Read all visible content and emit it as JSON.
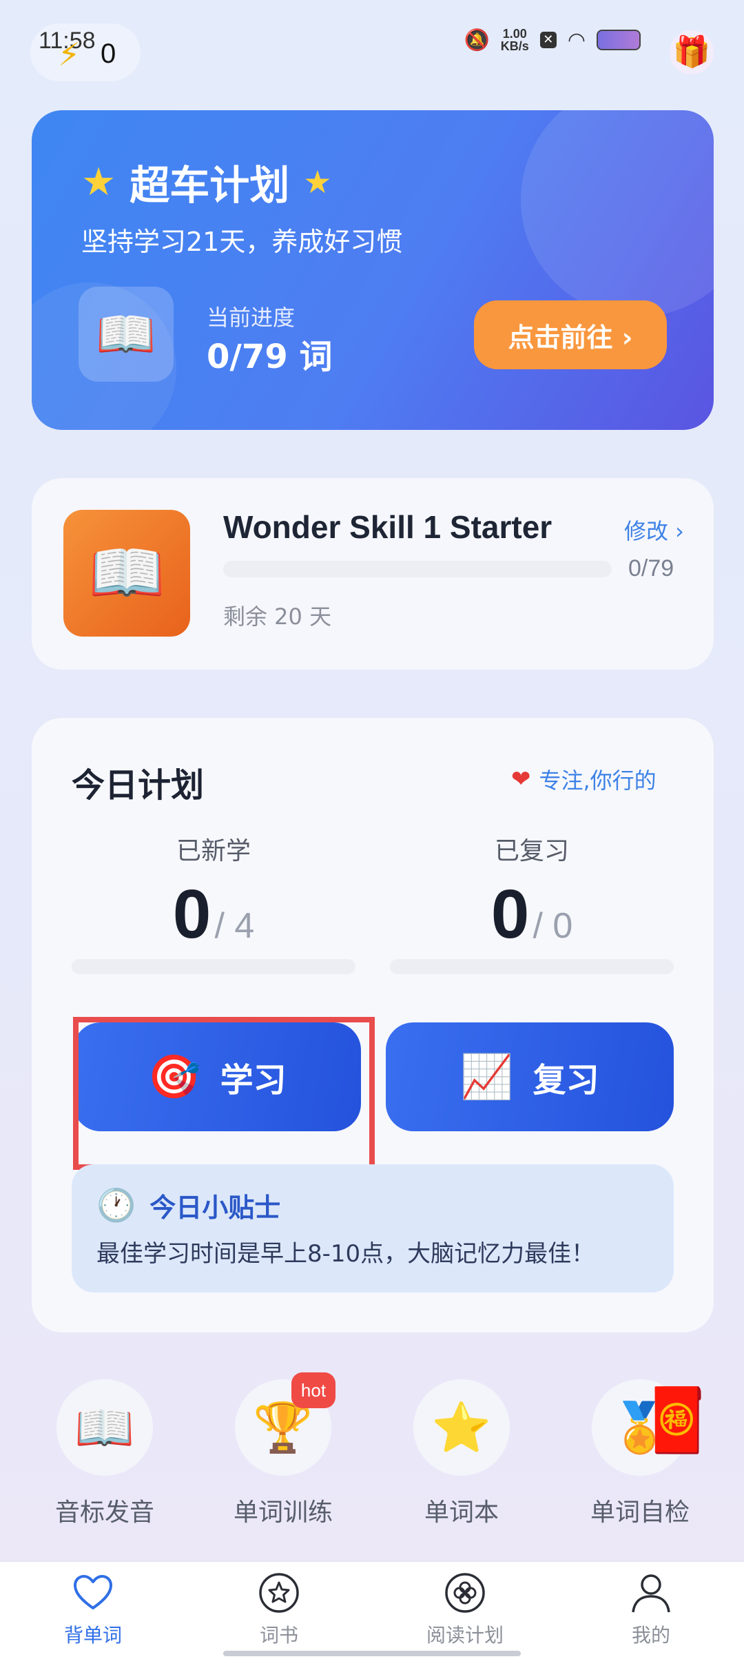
{
  "status_bar": {
    "time": "11:58",
    "notification_count": "0",
    "net_speed_value": "1.00",
    "net_speed_unit": "KB/s"
  },
  "hero": {
    "title": "超车计划",
    "subtitle": "坚持学习21天，养成好习惯",
    "progress_label": "当前进度",
    "progress_value": "0/79 词",
    "cta_label": "点击前往 ›"
  },
  "book": {
    "title": "Wonder Skill 1 Starter",
    "edit_label": "修改 ›",
    "progress_text": "0/79",
    "progress_fraction": 0,
    "remaining": "剩余 20 天"
  },
  "plan": {
    "title": "今日计划",
    "slogan": "专注,你行的",
    "new_label": "已新学",
    "new_done": "0",
    "new_total": "/ 4",
    "review_label": "已复习",
    "review_done": "0",
    "review_total": "/ 0",
    "study_button": "学习",
    "review_button": "复习",
    "tip_title": "今日小贴士",
    "tip_text": "最佳学习时间是早上8-10点，大脑记忆力最佳！"
  },
  "quick_entries": [
    {
      "label": "音标发音",
      "icon": "book-icon"
    },
    {
      "label": "单词训练",
      "icon": "trophy-icon",
      "badge": "hot"
    },
    {
      "label": "单词本",
      "icon": "star-icon"
    },
    {
      "label": "单词自检",
      "icon": "medal-icon"
    }
  ],
  "bottom_nav": [
    {
      "label": "背单词",
      "icon": "heart-icon",
      "active": true
    },
    {
      "label": "词书",
      "icon": "star-circle-icon",
      "active": false
    },
    {
      "label": "阅读计划",
      "icon": "flower-icon",
      "active": false
    },
    {
      "label": "我的",
      "icon": "person-icon",
      "active": false
    }
  ],
  "colors": {
    "accent": "#2f6fe6",
    "cta_orange": "#f9973e",
    "highlight_red": "#e84c4c",
    "hot_badge": "#f04a45"
  }
}
